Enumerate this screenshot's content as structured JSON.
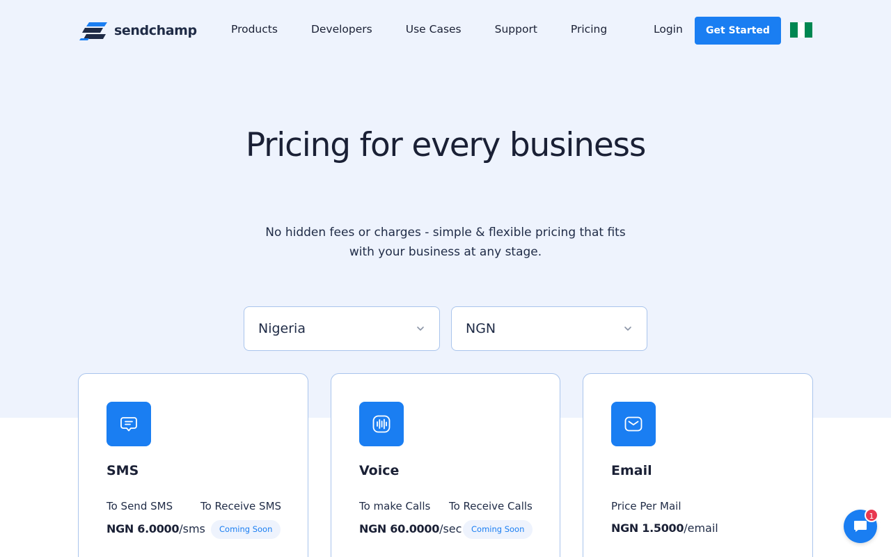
{
  "brand": {
    "name": "sendchamp",
    "accent": "#1a7ef2",
    "logo_icon": "sendchamp-logo-icon"
  },
  "nav": {
    "links": [
      "Products",
      "Developers",
      "Use Cases",
      "Support",
      "Pricing"
    ],
    "login": "Login",
    "cta": "Get Started",
    "flag": {
      "icon": "nigeria-flag-icon",
      "colors": [
        "#008751",
        "#ffffff",
        "#008751"
      ]
    }
  },
  "hero": {
    "title": "Pricing for every business",
    "subtitle": "No hidden fees or charges - simple & flexible pricing that fits with your business at any stage."
  },
  "filters": {
    "country": {
      "value": "Nigeria",
      "icon": "chevron-down-icon"
    },
    "currency": {
      "value": "NGN",
      "icon": "chevron-down-icon"
    }
  },
  "cards": [
    {
      "title": "SMS",
      "icon": "chat-message-icon",
      "col1_label": "To Send SMS",
      "col1_price": "NGN 6.0000",
      "col1_unit": "/sms",
      "col2_label": "To Receive SMS",
      "col2_badge": "Coming Soon"
    },
    {
      "title": "Voice",
      "icon": "sound-wave-icon",
      "col1_label": "To make Calls",
      "col1_price": "NGN 60.0000",
      "col1_unit": "/sec",
      "col2_label": "To Receive Calls",
      "col2_badge": "Coming Soon"
    },
    {
      "title": "Email",
      "icon": "envelope-icon",
      "col1_label": "Price Per Mail",
      "col1_price": "NGN 1.5000",
      "col1_unit": "/email"
    }
  ],
  "chat": {
    "icon": "chat-bubble-icon",
    "badge_count": "1"
  }
}
